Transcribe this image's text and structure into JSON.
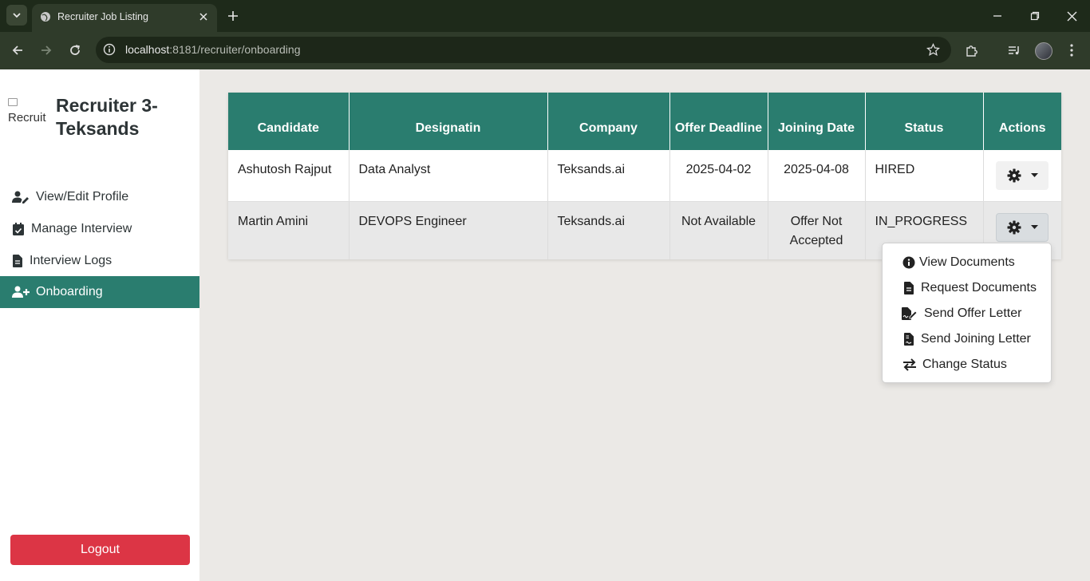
{
  "browser": {
    "tab_title": "Recruiter Job Listing",
    "url_host": "localhost",
    "url_path": ":8181/recruiter/onboarding"
  },
  "sidebar": {
    "logo_alt": "Recruit",
    "brand": "Recruiter 3-Teksands",
    "items": [
      {
        "label": "View/Edit Profile",
        "icon": "user-edit-icon"
      },
      {
        "label": "Manage Interview",
        "icon": "calendar-check-icon"
      },
      {
        "label": "Interview Logs",
        "icon": "file-icon"
      },
      {
        "label": "Onboarding",
        "icon": "user-plus-icon",
        "active": true
      }
    ],
    "logout_label": "Logout"
  },
  "table": {
    "headers": [
      "Candidate",
      "Designatin",
      "Company",
      "Offer Deadline",
      "Joining Date",
      "Status",
      "Actions"
    ],
    "rows": [
      {
        "candidate": "Ashutosh Rajput",
        "designation": "Data Analyst",
        "company": "Teksands.ai",
        "offer_deadline": "2025-04-02",
        "joining_date": "2025-04-08",
        "status": "HIRED"
      },
      {
        "candidate": "Martin Amini",
        "designation": "DEVOPS Engineer",
        "company": "Teksands.ai",
        "offer_deadline": "Not Available",
        "joining_date": "Offer Not Accepted",
        "status": "IN_PROGRESS"
      }
    ]
  },
  "actions_menu": {
    "items": [
      {
        "label": "View Documents",
        "icon": "info-circle-icon"
      },
      {
        "label": "Request Documents",
        "icon": "file-text-icon"
      },
      {
        "label": "Send Offer Letter",
        "icon": "file-signature-icon"
      },
      {
        "label": "Send Joining Letter",
        "icon": "file-contract-icon"
      },
      {
        "label": "Change Status",
        "icon": "exchange-arrows-icon"
      }
    ]
  },
  "colors": {
    "primary": "#2a7d6f",
    "danger": "#dc3545",
    "page_bg": "#ebe9e6"
  }
}
